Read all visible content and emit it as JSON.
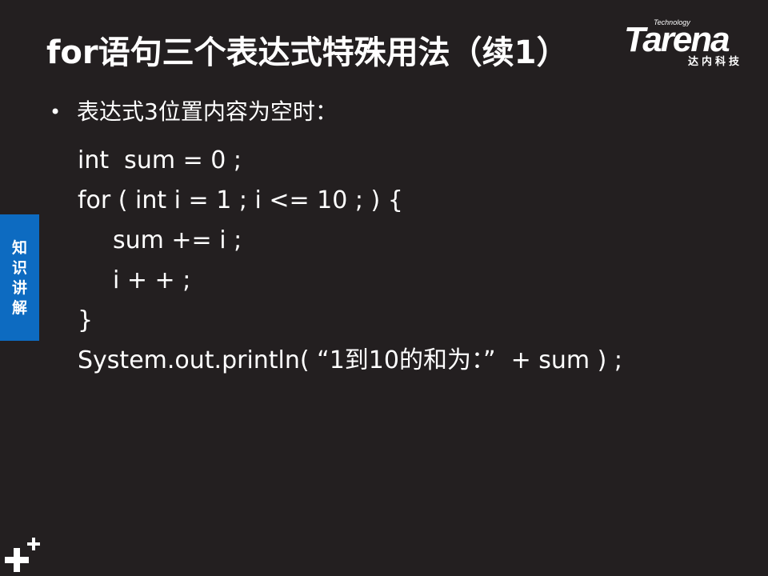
{
  "slide": {
    "title": "for语句三个表达式特殊用法（续1）",
    "bullet_text": "表达式3位置内容为空时："
  },
  "logo": {
    "brand": "Tarena",
    "tagline": "Technology",
    "chinese": "达内科技"
  },
  "code_lines": [
    "int  sum = 0 ;",
    "for ( int i = 1 ; i <= 10 ; ) {",
    "sum += i ;",
    "i + + ;",
    "}",
    "System.out.println( “1到10的和为：”  + sum ) ;"
  ],
  "side_tab": {
    "chars": [
      "知",
      "识",
      "讲",
      "解"
    ]
  },
  "colors": {
    "background": "#231f20",
    "text": "#ffffff",
    "tab": "#0d6bc1"
  }
}
